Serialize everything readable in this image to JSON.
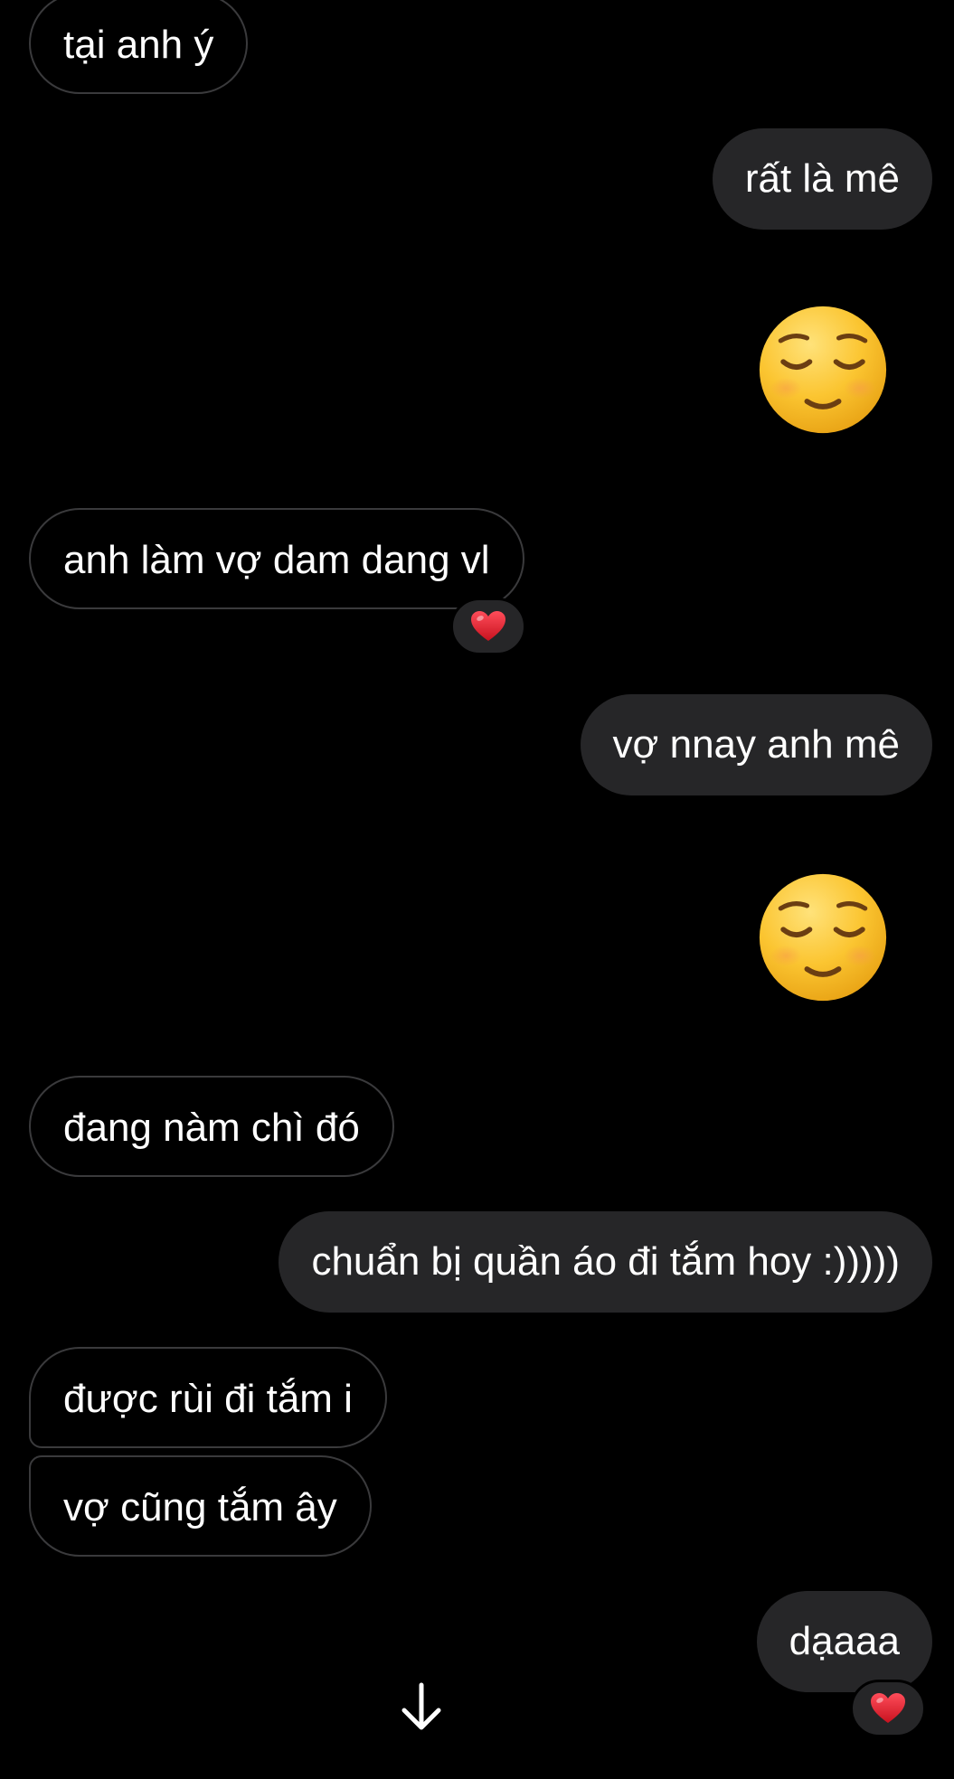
{
  "messages": [
    {
      "side": "in",
      "text": "tại anh ý"
    },
    {
      "side": "out",
      "text": "rất là mê"
    },
    {
      "side": "out",
      "emoji": "relieved-face"
    },
    {
      "side": "in",
      "text": "anh làm vợ dam dang vl",
      "reaction": "heart"
    },
    {
      "side": "out",
      "text": "vợ nnay anh mê"
    },
    {
      "side": "out",
      "emoji": "relieved-face"
    },
    {
      "side": "in",
      "text": "đang nàm chì đó"
    },
    {
      "side": "out",
      "text": "chuẩn bị quần áo đi tắm hoy :)))))"
    },
    {
      "side": "in",
      "text": "được rùi đi tắm i"
    },
    {
      "side": "in",
      "text": "vợ cũng tắm ây"
    },
    {
      "side": "out",
      "text": "dạaaa",
      "reaction": "heart"
    }
  ],
  "colors": {
    "background": "#000000",
    "outgoing_bubble": "#262628",
    "incoming_border": "#3a3a3c",
    "text": "#ffffff",
    "heart": "#e0242f",
    "emoji_face": "#f6b828"
  },
  "icons": {
    "scroll_down": "arrow-down-icon"
  }
}
